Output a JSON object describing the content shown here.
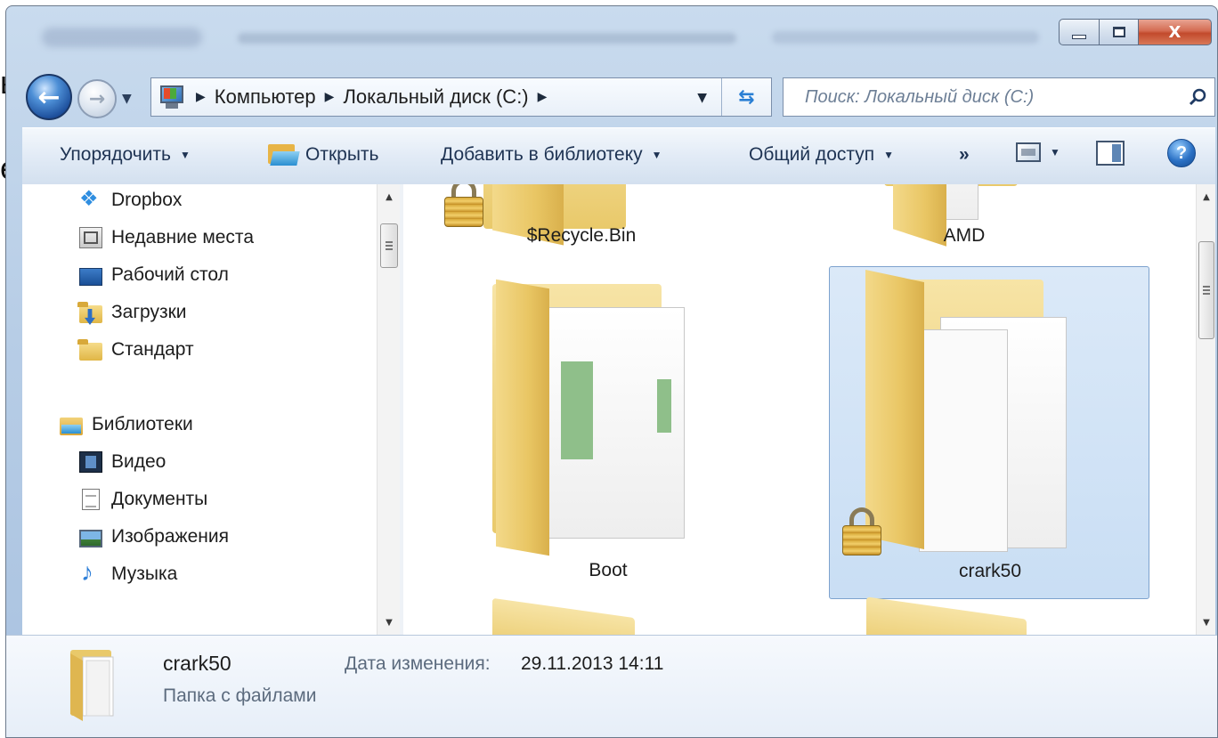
{
  "background_text": [
    "ы",
    "е"
  ],
  "window": {
    "caption": {
      "minimize": "",
      "maximize": "",
      "close": "X"
    }
  },
  "navigation": {
    "breadcrumbs": [
      "Компьютер",
      "Локальный диск (C:)"
    ],
    "search_placeholder": "Поиск: Локальный диск (C:)"
  },
  "toolbar": {
    "organize": "Упорядочить",
    "open": "Открыть",
    "add_to_library": "Добавить в библиотеку",
    "share": "Общий доступ",
    "more": "»",
    "help": "?"
  },
  "nav_pane": {
    "favorites": [
      {
        "label": "Dropbox",
        "icon": "dropbox-icon"
      },
      {
        "label": "Недавние места",
        "icon": "recent-places-icon"
      },
      {
        "label": "Рабочий стол",
        "icon": "desktop-icon"
      },
      {
        "label": "Загрузки",
        "icon": "downloads-icon"
      },
      {
        "label": "Стандарт",
        "icon": "folder-icon"
      }
    ],
    "libraries_label": "Библиотеки",
    "libraries": [
      {
        "label": "Видео",
        "icon": "video-icon"
      },
      {
        "label": "Документы",
        "icon": "documents-icon"
      },
      {
        "label": "Изображения",
        "icon": "pictures-icon"
      },
      {
        "label": "Музыка",
        "icon": "music-icon"
      }
    ]
  },
  "files": [
    {
      "name": "$Recycle.Bin",
      "locked": true,
      "selected": false
    },
    {
      "name": "AMD",
      "locked": false,
      "selected": false
    },
    {
      "name": "Boot",
      "locked": false,
      "selected": false
    },
    {
      "name": "crark50",
      "locked": true,
      "selected": true
    }
  ],
  "details": {
    "name": "crark50",
    "type": "Папка с файлами",
    "date_label": "Дата изменения:",
    "date_value": "29.11.2013 14:11"
  },
  "colors": {
    "selection": "#c9def4",
    "selection_border": "#7da2ce",
    "close_button": "#c24a2c",
    "toolbar_text": "#1e3353"
  }
}
